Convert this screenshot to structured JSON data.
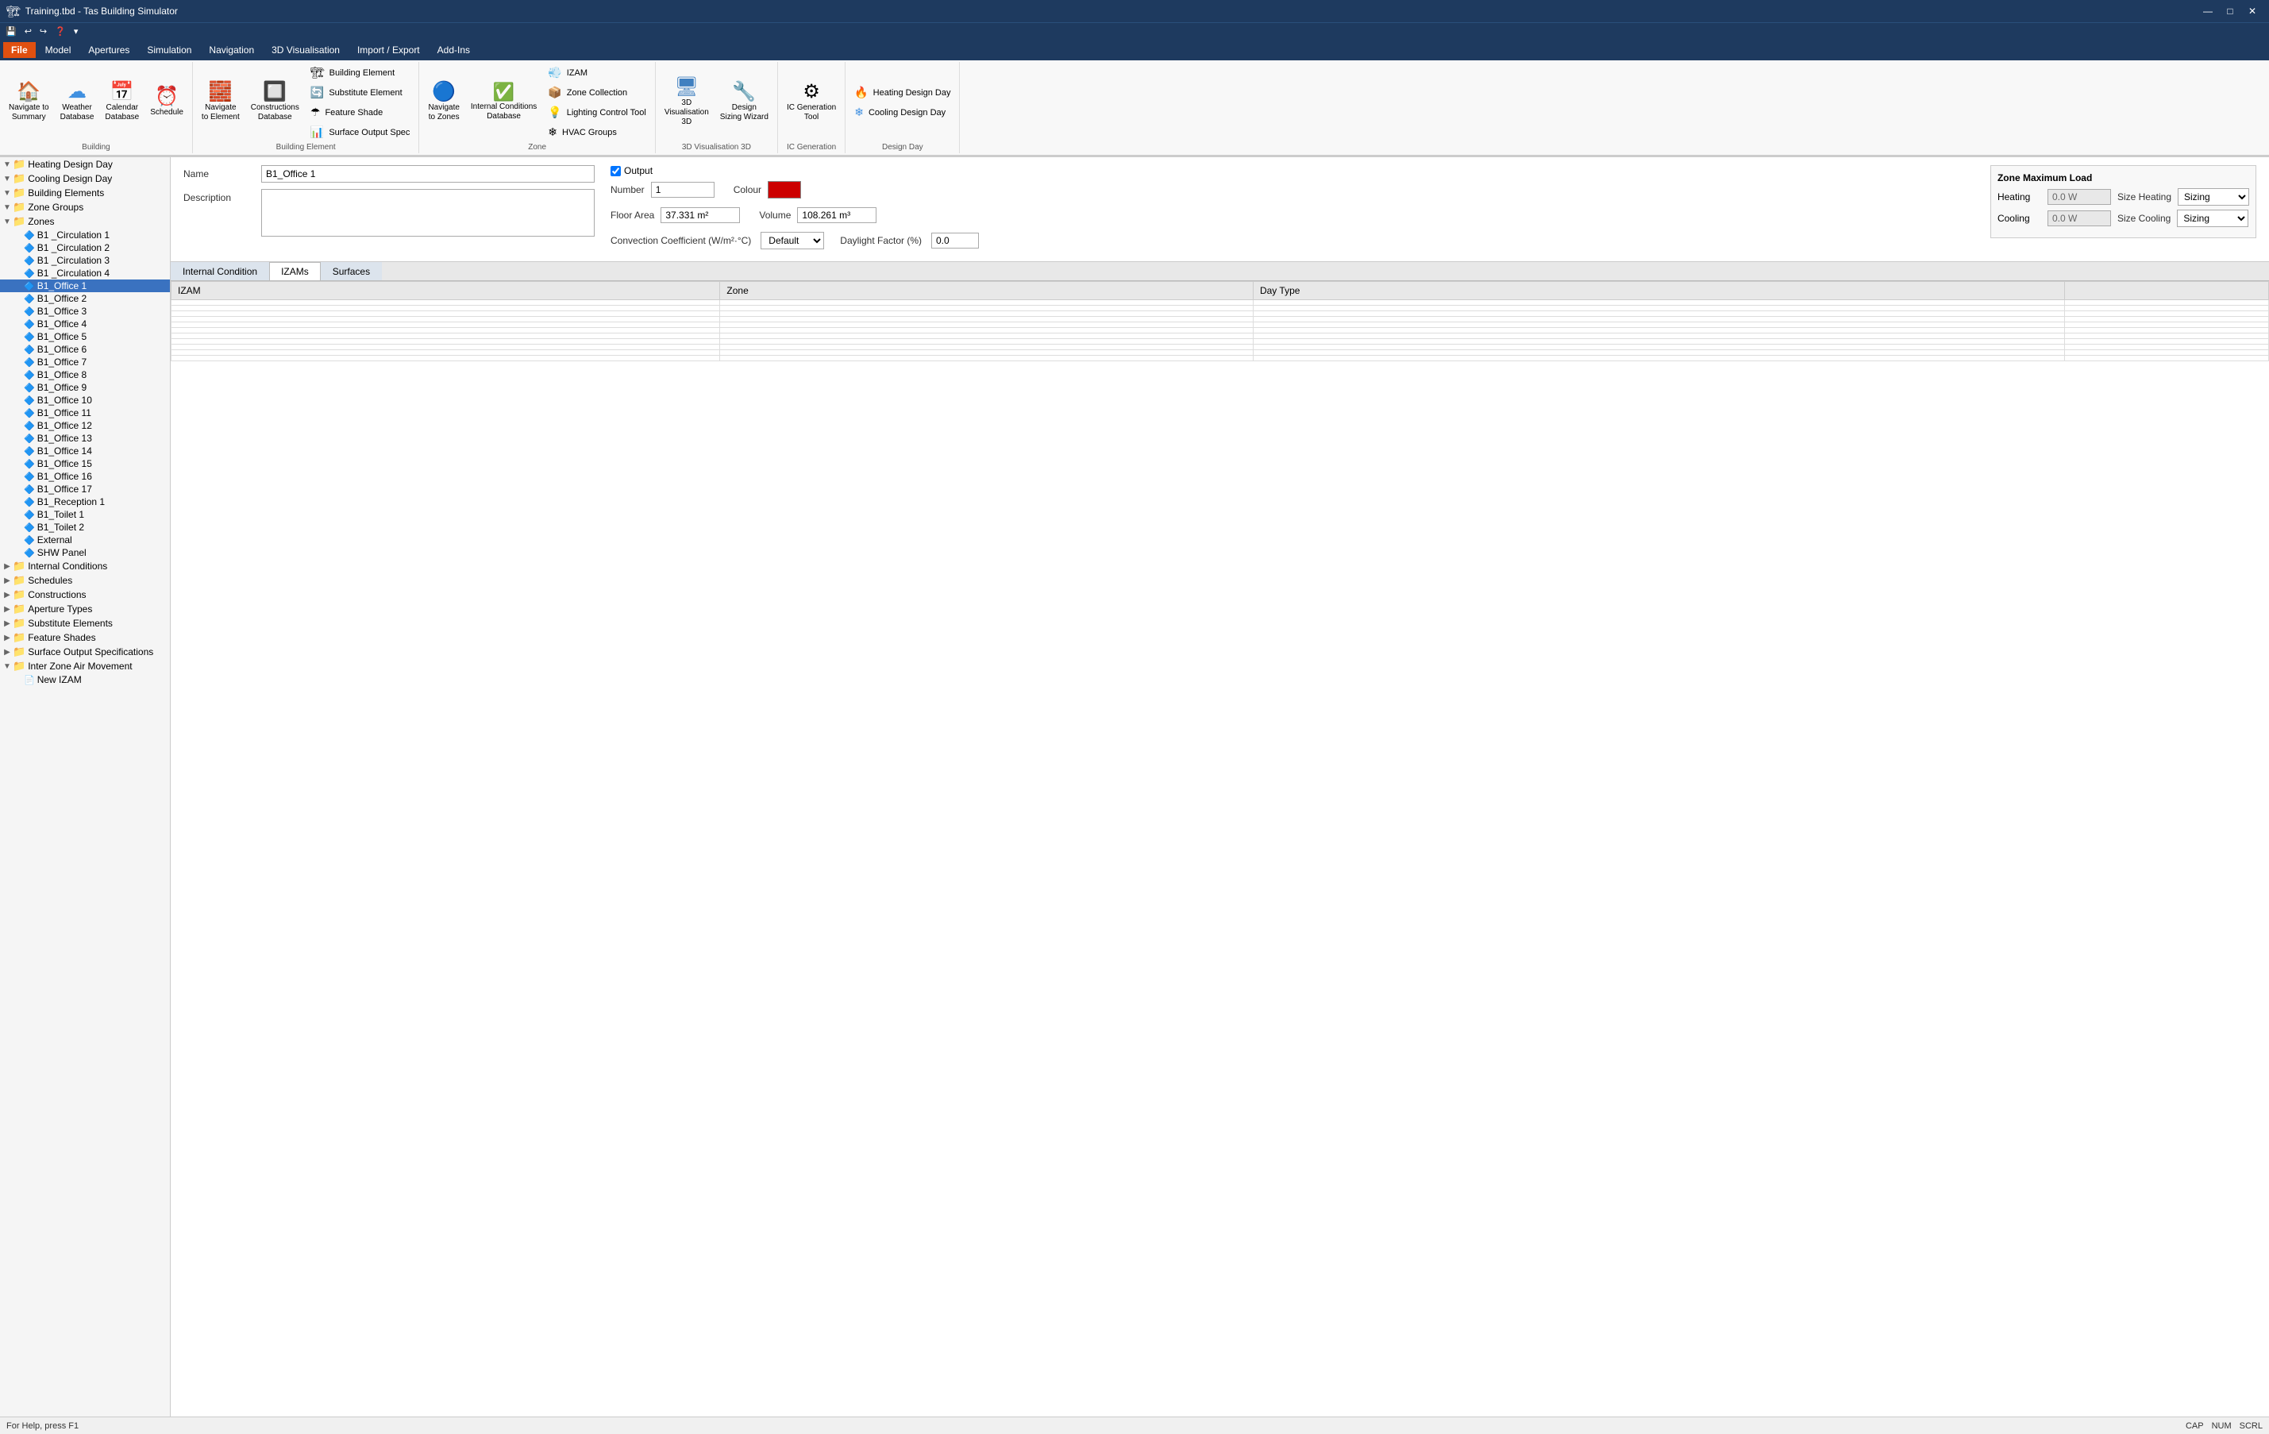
{
  "titlebar": {
    "title": "Training.tbd - Tas Building Simulator",
    "minimize": "—",
    "maximize": "□",
    "close": "✕"
  },
  "quickaccess": {
    "buttons": [
      "💾",
      "↩",
      "↪",
      "❓",
      "▾"
    ]
  },
  "menubar": {
    "file": "File",
    "items": [
      "Model",
      "Apertures",
      "Simulation",
      "Navigation",
      "3D Visualisation",
      "Import / Export",
      "Add-Ins"
    ]
  },
  "ribbon": {
    "groups": [
      {
        "name": "Building",
        "buttons": [
          {
            "id": "navigate-summary",
            "icon": "🏠",
            "label": "Navigate to\nSummary"
          },
          {
            "id": "weather",
            "icon": "☁",
            "label": "Weather\nDatabase"
          },
          {
            "id": "calendar",
            "icon": "📅",
            "label": "Calendar\nDatabase"
          },
          {
            "id": "schedule",
            "icon": "⏰",
            "label": "Schedule"
          }
        ]
      },
      {
        "name": "Building Element",
        "buttons": [
          {
            "id": "navigate-element",
            "icon": "🧱",
            "label": "Navigate\nto Element"
          },
          {
            "id": "constructions",
            "icon": "🔲",
            "label": "Constructions\nDatabase"
          },
          {
            "id": "building-element",
            "icon": "🏗",
            "label": "Building Element"
          },
          {
            "id": "substitute-element",
            "icon": "🔄",
            "label": "Substitute Element"
          },
          {
            "id": "feature-shade",
            "icon": "☂",
            "label": "Feature Shade"
          },
          {
            "id": "surface-output",
            "icon": "📊",
            "label": "Surface Output Spec"
          }
        ]
      },
      {
        "name": "Zone",
        "buttons": [
          {
            "id": "navigate-zones",
            "icon": "🔵",
            "label": "Navigate\nto Zones"
          },
          {
            "id": "internal-conditions",
            "icon": "✅",
            "label": "Internal Conditions\nDatabase"
          },
          {
            "id": "izam",
            "icon": "💨",
            "label": "IZAM"
          },
          {
            "id": "zone-collection",
            "icon": "📦",
            "label": "Zone Collection"
          },
          {
            "id": "lighting-control",
            "icon": "💡",
            "label": "Lighting Control Tool"
          },
          {
            "id": "hvac-groups",
            "icon": "❄",
            "label": "HVAC Groups"
          }
        ]
      },
      {
        "name": "3D",
        "buttons": [
          {
            "id": "3d-vis",
            "icon": "🖥",
            "label": "3D\nVisualisation\n3D"
          },
          {
            "id": "design-wizard",
            "icon": "🔧",
            "label": "Design\nSizing Wizard"
          }
        ]
      },
      {
        "name": "Design Day",
        "buttons": [
          {
            "id": "heating-design",
            "icon": "🔥",
            "label": "Heating Design Day"
          },
          {
            "id": "cooling-design",
            "icon": "❄",
            "label": "Cooling Design Day"
          }
        ]
      },
      {
        "name": "IC Generation",
        "buttons": [
          {
            "id": "ic-gen",
            "icon": "⚙",
            "label": "IC Generation Tool"
          }
        ]
      }
    ]
  },
  "sidebar": {
    "items": [
      {
        "level": 0,
        "type": "folder",
        "expanded": true,
        "text": "Heating Design Day",
        "selected": false
      },
      {
        "level": 0,
        "type": "folder",
        "expanded": true,
        "text": "Cooling Design Day",
        "selected": false
      },
      {
        "level": 0,
        "type": "folder",
        "expanded": true,
        "text": "Building Elements",
        "selected": false
      },
      {
        "level": 0,
        "type": "folder",
        "expanded": true,
        "text": "Zone Groups",
        "selected": false
      },
      {
        "level": 0,
        "type": "folder",
        "expanded": true,
        "text": "Zones",
        "selected": false
      },
      {
        "level": 1,
        "type": "zone",
        "expanded": false,
        "text": "B1 _Circulation 1",
        "selected": false
      },
      {
        "level": 1,
        "type": "zone",
        "expanded": false,
        "text": "B1 _Circulation 2",
        "selected": false
      },
      {
        "level": 1,
        "type": "zone",
        "expanded": false,
        "text": "B1 _Circulation 3",
        "selected": false
      },
      {
        "level": 1,
        "type": "zone",
        "expanded": false,
        "text": "B1 _Circulation 4",
        "selected": false
      },
      {
        "level": 1,
        "type": "zone",
        "expanded": false,
        "text": "B1_Office 1",
        "selected": true
      },
      {
        "level": 1,
        "type": "zone",
        "expanded": false,
        "text": "B1_Office 2",
        "selected": false
      },
      {
        "level": 1,
        "type": "zone",
        "expanded": false,
        "text": "B1_Office 3",
        "selected": false
      },
      {
        "level": 1,
        "type": "zone",
        "expanded": false,
        "text": "B1_Office 4",
        "selected": false
      },
      {
        "level": 1,
        "type": "zone",
        "expanded": false,
        "text": "B1_Office 5",
        "selected": false
      },
      {
        "level": 1,
        "type": "zone",
        "expanded": false,
        "text": "B1_Office 6",
        "selected": false
      },
      {
        "level": 1,
        "type": "zone",
        "expanded": false,
        "text": "B1_Office 7",
        "selected": false
      },
      {
        "level": 1,
        "type": "zone",
        "expanded": false,
        "text": "B1_Office 8",
        "selected": false
      },
      {
        "level": 1,
        "type": "zone",
        "expanded": false,
        "text": "B1_Office 9",
        "selected": false
      },
      {
        "level": 1,
        "type": "zone",
        "expanded": false,
        "text": "B1_Office 10",
        "selected": false
      },
      {
        "level": 1,
        "type": "zone",
        "expanded": false,
        "text": "B1_Office 11",
        "selected": false
      },
      {
        "level": 1,
        "type": "zone",
        "expanded": false,
        "text": "B1_Office 12",
        "selected": false
      },
      {
        "level": 1,
        "type": "zone",
        "expanded": false,
        "text": "B1_Office 13",
        "selected": false
      },
      {
        "level": 1,
        "type": "zone",
        "expanded": false,
        "text": "B1_Office 14",
        "selected": false
      },
      {
        "level": 1,
        "type": "zone",
        "expanded": false,
        "text": "B1_Office 15",
        "selected": false
      },
      {
        "level": 1,
        "type": "zone",
        "expanded": false,
        "text": "B1_Office 16",
        "selected": false
      },
      {
        "level": 1,
        "type": "zone",
        "expanded": false,
        "text": "B1_Office 17",
        "selected": false
      },
      {
        "level": 1,
        "type": "zone",
        "expanded": false,
        "text": "B1_Reception 1",
        "selected": false
      },
      {
        "level": 1,
        "type": "zone",
        "expanded": false,
        "text": "B1_Toilet 1",
        "selected": false
      },
      {
        "level": 1,
        "type": "zone",
        "expanded": false,
        "text": "B1_Toilet 2",
        "selected": false
      },
      {
        "level": 1,
        "type": "zone",
        "expanded": false,
        "text": "External",
        "selected": false
      },
      {
        "level": 1,
        "type": "zone",
        "expanded": false,
        "text": "SHW Panel",
        "selected": false
      },
      {
        "level": 0,
        "type": "folder",
        "expanded": false,
        "text": "Internal Conditions",
        "selected": false
      },
      {
        "level": 0,
        "type": "folder",
        "expanded": false,
        "text": "Schedules",
        "selected": false
      },
      {
        "level": 0,
        "type": "folder",
        "expanded": false,
        "text": "Constructions",
        "selected": false
      },
      {
        "level": 0,
        "type": "folder",
        "expanded": false,
        "text": "Aperture Types",
        "selected": false
      },
      {
        "level": 0,
        "type": "folder",
        "expanded": false,
        "text": "Substitute Elements",
        "selected": false
      },
      {
        "level": 0,
        "type": "folder",
        "expanded": false,
        "text": "Feature Shades",
        "selected": false
      },
      {
        "level": 0,
        "type": "folder",
        "expanded": false,
        "text": "Surface Output Specifications",
        "selected": false
      },
      {
        "level": 0,
        "type": "folder",
        "expanded": true,
        "text": "Inter Zone Air Movement",
        "selected": false
      },
      {
        "level": 1,
        "type": "item",
        "expanded": false,
        "text": "New IZAM",
        "selected": false
      }
    ]
  },
  "zone": {
    "name": "B1_Office 1",
    "description": "",
    "output_checked": true,
    "output_label": "Output",
    "number": "1",
    "colour": "#cc0000",
    "floor_area": "37.331 m²",
    "volume": "108.261 m³",
    "convection_coefficient_label": "Convection Coefficient (W/m²·°C)",
    "convection_value": "Default",
    "daylight_factor_label": "Daylight Factor (%)",
    "daylight_value": "0.0",
    "tabs": [
      "Internal Condition",
      "IZAMs",
      "Surfaces"
    ],
    "active_tab": "IZAMs",
    "table_headers": [
      "IZAM",
      "Zone",
      "Day Type",
      ""
    ],
    "load_panel": {
      "title": "Zone Maximum Load",
      "heating_label": "Heating",
      "heating_value": "0.0 W",
      "size_heating_label": "Size Heating",
      "size_heating_value": "Sizing",
      "cooling_label": "Cooling",
      "cooling_value": "0.0 W",
      "size_cooling_label": "Size Cooling",
      "size_cooling_value": "Sizing"
    }
  },
  "statusbar": {
    "help_text": "For Help, press F1",
    "indicators": [
      "CAP",
      "NUM",
      "SCRL"
    ]
  }
}
